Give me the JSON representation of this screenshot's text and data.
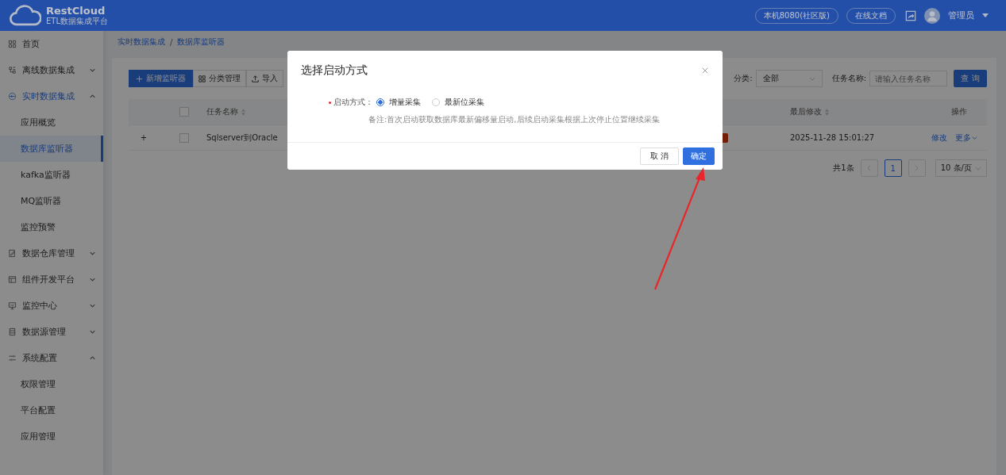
{
  "header": {
    "logo_title": "RestCloud",
    "logo_subtitle": "ETL数据集成平台",
    "links": [
      "本机8080(社区版)",
      "在线文档"
    ],
    "user": "管理员"
  },
  "sidebar": {
    "items": [
      {
        "label": "首页",
        "selected": false
      },
      {
        "label": "离线数据集成",
        "expanded": false,
        "selected": false
      },
      {
        "label": "实时数据集成",
        "expanded": true,
        "selected": true,
        "children": [
          {
            "label": "应用概览",
            "selected": false
          },
          {
            "label": "数据库监听器",
            "selected": true
          },
          {
            "label": "kafka监听器",
            "selected": false
          },
          {
            "label": "MQ监听器",
            "selected": false
          },
          {
            "label": "监控预警",
            "selected": false
          }
        ]
      },
      {
        "label": "数据仓库管理",
        "expanded": false,
        "selected": false
      },
      {
        "label": "组件开发平台",
        "expanded": false,
        "selected": false
      },
      {
        "label": "监控中心",
        "expanded": false,
        "selected": false
      },
      {
        "label": "数据源管理",
        "expanded": false,
        "selected": false
      },
      {
        "label": "系统配置",
        "expanded": true,
        "selected": false,
        "children": [
          {
            "label": "权限管理",
            "selected": false
          },
          {
            "label": "平台配置",
            "selected": false
          },
          {
            "label": "应用管理",
            "selected": false
          }
        ]
      }
    ]
  },
  "breadcrumb": {
    "items": [
      "实时数据集成",
      "数据库监听器"
    ],
    "separator": "/"
  },
  "toolbar": [
    {
      "label": "新增监听器",
      "kind": "primary"
    },
    {
      "label": "分类管理",
      "kind": "grid"
    },
    {
      "label": "导入",
      "kind": "import"
    }
  ],
  "filters": {
    "category_label": "分类:",
    "category_value": "全部",
    "name_label": "任务名称:",
    "name_placeholder": "请输入任务名称",
    "query_button": "查 询"
  },
  "table": {
    "columns": [
      "任务名称",
      "最后修改",
      "操作"
    ],
    "header_checked": false,
    "rows": [
      {
        "expand": "+",
        "checked": false,
        "name": "Sqlserver到Oracle",
        "modified": "2025-11-28 15:01:27",
        "actions": [
          "修改",
          "更多"
        ]
      }
    ]
  },
  "pagination": {
    "total": "共1条",
    "pages": [
      {
        "label": "1",
        "selected": true
      }
    ],
    "page_size": "10 条/页"
  },
  "modal": {
    "title": "选择启动方式",
    "field_label": "启动方式：",
    "options": [
      {
        "label": "增量采集",
        "selected": true
      },
      {
        "label": "最新位采集",
        "selected": false
      }
    ],
    "note": "备注:首次启动获取数据库最新偏移量启动,后续启动采集根据上次停止位置继续采集",
    "buttons": [
      {
        "label": "取 消",
        "kind": "default"
      },
      {
        "label": "确定",
        "kind": "primary"
      }
    ]
  }
}
